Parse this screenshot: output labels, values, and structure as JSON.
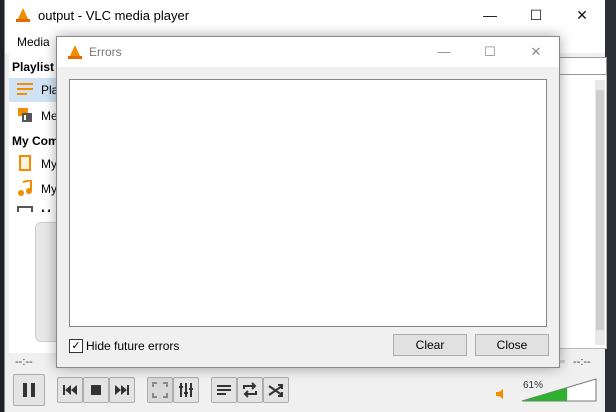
{
  "window": {
    "title": "output - VLC media player"
  },
  "menubar": {
    "media": "Media"
  },
  "sidebar": {
    "playlist_header": "Playlist",
    "items": [
      {
        "label": "Play",
        "icon": "playlist-icon"
      },
      {
        "label": "Me",
        "icon": "media-library-icon"
      }
    ],
    "computer_header": "My Comp",
    "computer_items": [
      {
        "label": "My",
        "icon": "videos-icon"
      },
      {
        "label": "My",
        "icon": "music-icon"
      },
      {
        "label": "M",
        "icon": "pictures-icon"
      }
    ]
  },
  "timeline": {
    "elapsed": "--:--",
    "total": "--:--"
  },
  "volume": {
    "percent_label": "61%",
    "level": 0.61
  },
  "dialog": {
    "title": "Errors",
    "hide_label": "Hide future errors",
    "hide_checked": "✓",
    "clear_label": "Clear",
    "close_label": "Close"
  },
  "colors": {
    "accent": "#f28c00",
    "volume_fill": "#30b030"
  }
}
